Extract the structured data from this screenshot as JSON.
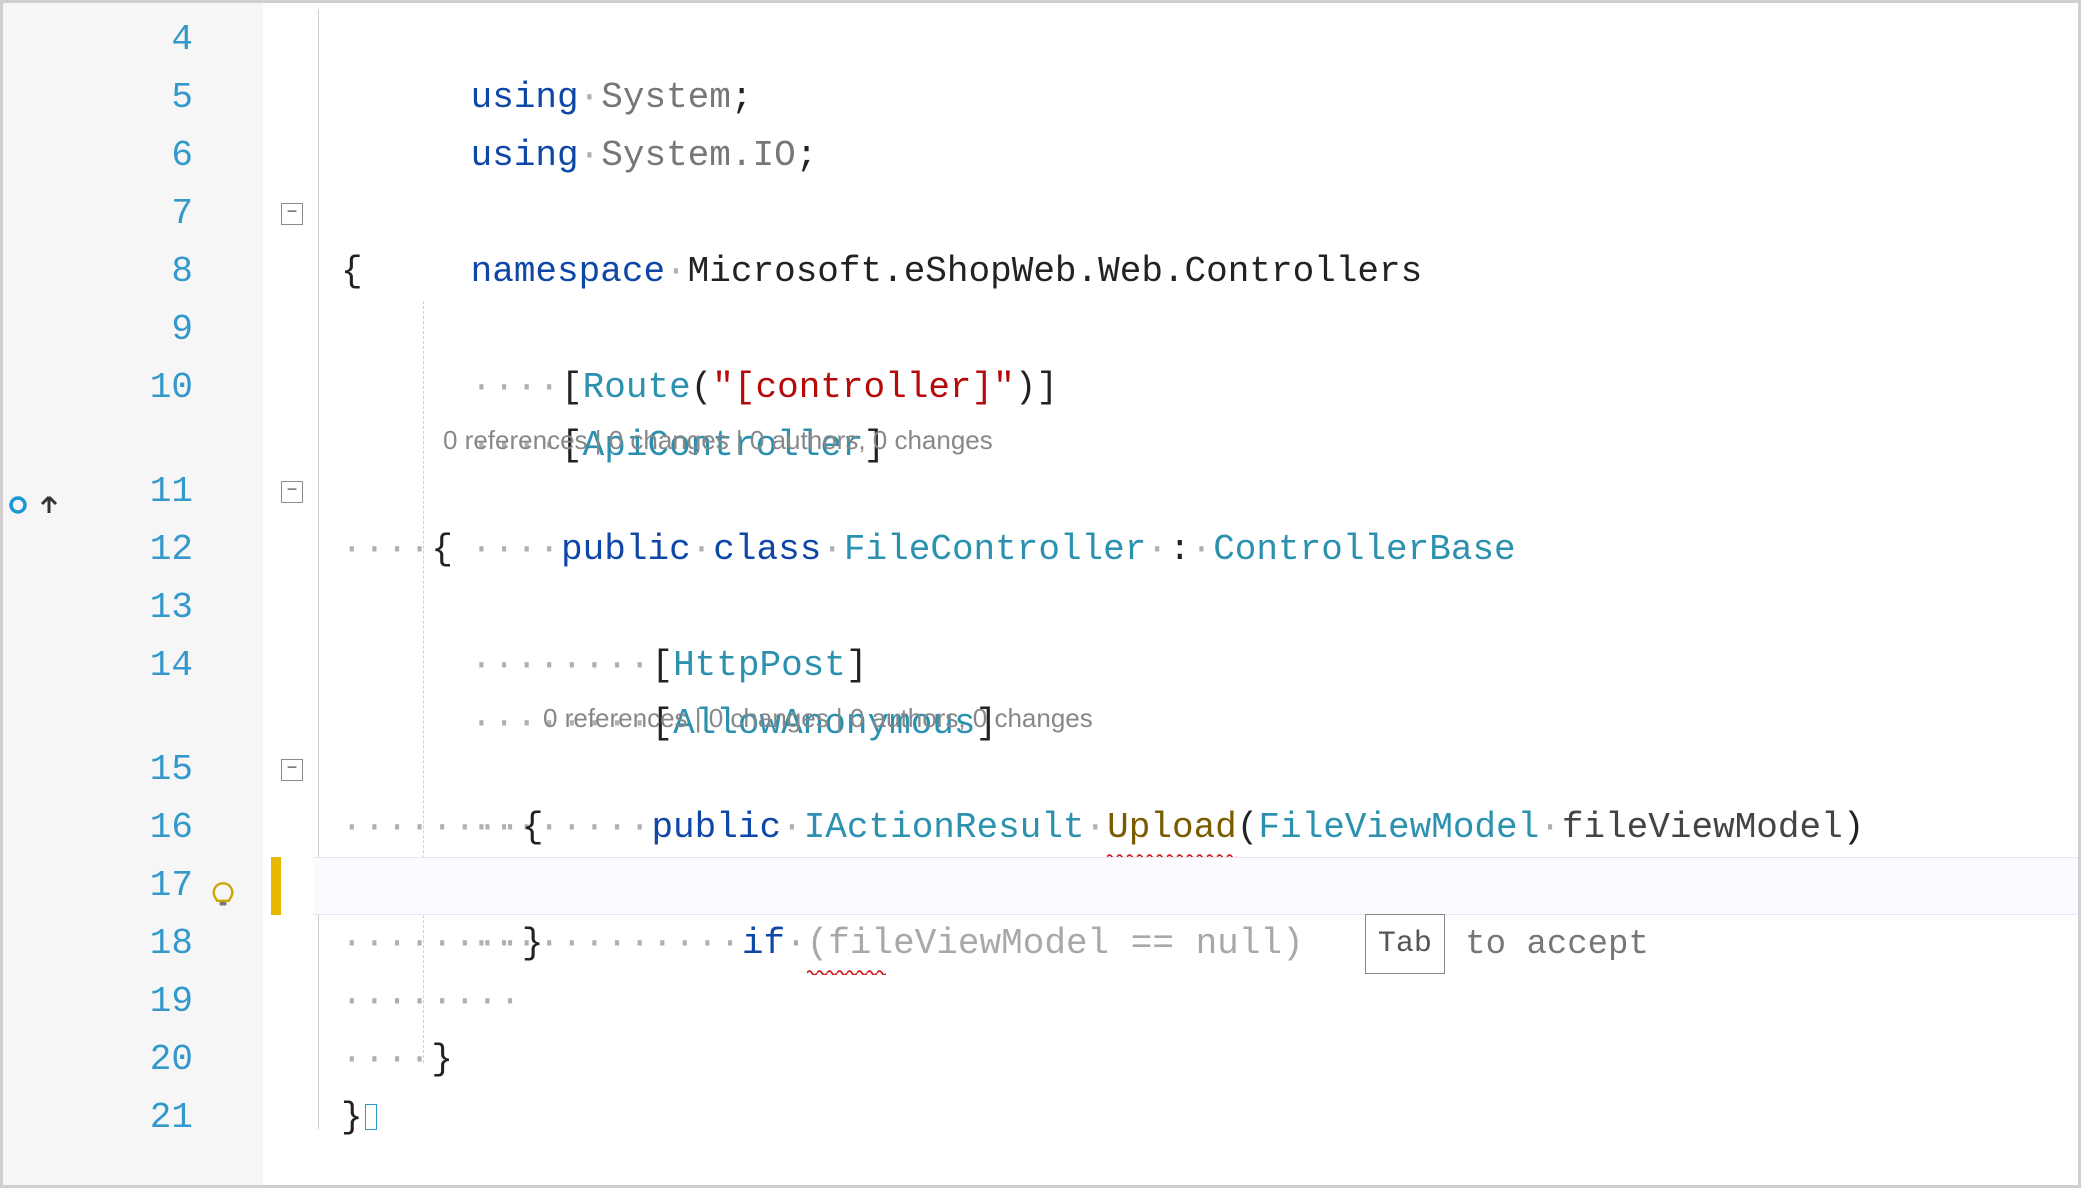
{
  "editor": {
    "line_numbers": [
      "4",
      "5",
      "6",
      "7",
      "8",
      "9",
      "10",
      "11",
      "12",
      "13",
      "14",
      "15",
      "16",
      "17",
      "18",
      "19",
      "20",
      "21"
    ],
    "colors": {
      "keyword": "#0f47a7",
      "type": "#2b91af",
      "string": "#b50a0a",
      "identifier": "#222222",
      "ghost": "#a8a8a8",
      "codelens": "#888888",
      "line_number": "#3399cc",
      "change_bar": "#e6b800"
    },
    "suggestion": {
      "key_label": "Tab",
      "hint": " to accept"
    },
    "codelens_text": "0 references | 0 changes | 0 authors, 0 changes",
    "lines": {
      "l4": {
        "using": "using",
        "sp": "·",
        "ns": "System",
        "end": ";"
      },
      "l5": {
        "using": "using",
        "sp": "·",
        "ns": "System.IO",
        "end": ";"
      },
      "l7": {
        "kw": "namespace",
        "sp": "·",
        "ns": "Microsoft.eShopWeb.Web.Controllers"
      },
      "l8": {
        "brace": "{"
      },
      "l9": {
        "dots": "····",
        "lb": "[",
        "attr": "Route",
        "open": "(",
        "str": "\"[controller]\"",
        "close": ")",
        "rb": "]"
      },
      "l10": {
        "dots": "····",
        "lb": "[",
        "attr": "ApiController",
        "rb": "]"
      },
      "l11": {
        "dots": "····",
        "public": "public",
        "sp": "·",
        "class": "class",
        "sp2": "·",
        "name": "FileController",
        "sp3": "·",
        "colon": ":",
        "sp4": "·",
        "base": "ControllerBase"
      },
      "l12": {
        "dots": "····",
        "brace": "{"
      },
      "l13": {
        "dots": "········",
        "lb": "[",
        "attr": "HttpPost",
        "rb": "]"
      },
      "l14": {
        "dots": "········",
        "lb": "[",
        "attr": "AllowAnonymous",
        "rb": "]"
      },
      "l15": {
        "dots": "········",
        "public": "public",
        "sp": "·",
        "ret": "IActionResult",
        "sp2": "·",
        "method": "Upload",
        "open": "(",
        "ptype": "FileViewModel",
        "sp3": "·",
        "pname": "fileViewModel",
        "close": ")"
      },
      "l16": {
        "dots": "········",
        "brace": "{"
      },
      "l17": {
        "dots": "············",
        "if": "if",
        "sp": "·",
        "rest": "(fileViewModel == null)"
      },
      "l18": {
        "dots": "········",
        "brace": "}"
      },
      "l19": {
        "dots": "········"
      },
      "l20": {
        "dots": "····",
        "brace": "}"
      },
      "l21": {
        "brace": "}"
      }
    }
  },
  "icons": {
    "lightbulb": "lightbulb-icon",
    "nav_up": "navigate-up-icon",
    "nav_target": "navigate-target-icon"
  }
}
